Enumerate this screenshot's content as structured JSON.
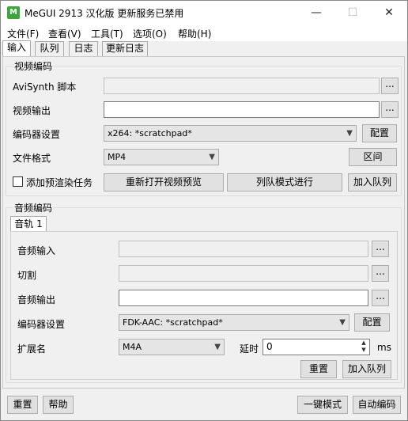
{
  "window": {
    "title": "MeGUI 2913 汉化版 更新服务已禁用",
    "icon_label": "M",
    "controls": {
      "minimize": "—",
      "maximize": "☐",
      "close": "✕"
    }
  },
  "menu": [
    "文件(F)",
    "查看(V)",
    "工具(T)",
    "选项(O)",
    "帮助(H)"
  ],
  "tabs": [
    "输入",
    "队列",
    "日志",
    "更新日志"
  ],
  "video": {
    "group_title": "视频编码",
    "avisynth_label": "AviSynth 脚本",
    "avisynth_value": "",
    "output_label": "视频输出",
    "output_value": "",
    "encoder_label": "编码器设置",
    "encoder_value": "x264: *scratchpad*",
    "config_btn": "配置",
    "format_label": "文件格式",
    "format_value": "MP4",
    "zone_btn": "区间",
    "prerender_label": "添加预渲染任务",
    "preview_btn": "重新打开视频预览",
    "queue_mode_btn": "列队模式进行",
    "add_queue_btn": "加入队列",
    "browse_btn": "..."
  },
  "audio": {
    "group_title": "音频编码",
    "track_tab": "音轨 1",
    "input_label": "音频输入",
    "input_value": "",
    "cut_label": "切割",
    "cut_value": "",
    "output_label": "音频输出",
    "output_value": "",
    "encoder_label": "编码器设置",
    "encoder_value": "FDK-AAC: *scratchpad*",
    "config_btn": "配置",
    "ext_label": "扩展名",
    "ext_value": "M4A",
    "delay_label": "延时",
    "delay_value": "0",
    "delay_unit": "ms",
    "reset_btn": "重置",
    "add_queue_btn": "加入队列",
    "browse_btn": "..."
  },
  "footer": {
    "reset_btn": "重置",
    "help_btn": "帮助",
    "oneclick_btn": "一键模式",
    "autoencode_btn": "自动编码"
  }
}
